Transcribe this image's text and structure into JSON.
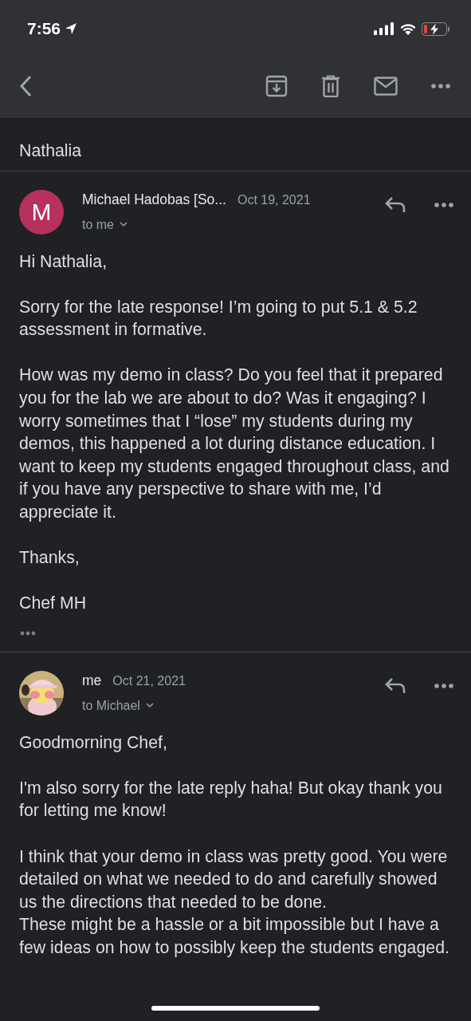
{
  "status_bar": {
    "time": "7:56"
  },
  "messages": [
    {
      "kind": "tail",
      "blocks": [
        [
          "Nathalia"
        ]
      ]
    },
    {
      "kind": "full",
      "sender": "Michael Hadobas [So...",
      "date": "Oct 19, 2021",
      "recipient": "to me",
      "avatar": {
        "kind": "letter",
        "letter": "M",
        "color": "#b8305c"
      },
      "has_trimmed_content": true,
      "blocks": [
        [
          "Hi Nathalia,"
        ],
        [
          "Sorry for the late response! I’m going to put 5.1 & 5.2 assessment in formative."
        ],
        [
          "How was my demo in class? Do you feel that it prepared you for the lab we are about to do? Was it engaging? I worry sometimes that I “lose” my students during my demos, this happened a lot during distance education. I want to keep my students engaged throughout class, and if you have any perspective to share with me, I’d appreciate it."
        ],
        [
          "Thanks,"
        ],
        [
          "Chef MH"
        ]
      ]
    },
    {
      "kind": "full",
      "sender": "me",
      "date": "Oct 21, 2021",
      "recipient": "to Michael",
      "avatar": {
        "kind": "picture"
      },
      "blocks": [
        [
          "Goodmorning Chef,"
        ],
        [
          "I'm also sorry for the late reply haha! But okay thank you for letting me know!"
        ],
        [
          "I think that your demo in class was pretty good. You were detailed on what we needed to do and carefully showed us the directions that needed to be done.",
          "These might be a hassle or a bit impossible but I have a few ideas on how to possibly keep the students engaged."
        ]
      ]
    }
  ]
}
